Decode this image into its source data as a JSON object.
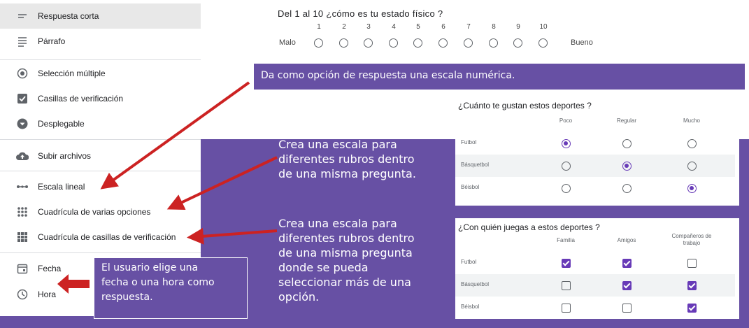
{
  "menu": {
    "items": [
      {
        "label": "Respuesta corta",
        "icon": "short-answer-icon"
      },
      {
        "label": "Párrafo",
        "icon": "paragraph-icon"
      },
      {
        "label": "Selección múltiple",
        "icon": "radio-icon"
      },
      {
        "label": "Casillas de verificación",
        "icon": "checkbox-icon"
      },
      {
        "label": "Desplegable",
        "icon": "dropdown-icon"
      },
      {
        "label": "Subir archivos",
        "icon": "cloud-upload-icon"
      },
      {
        "label": "Escala lineal",
        "icon": "linear-scale-icon"
      },
      {
        "label": "Cuadrícula de varias opciones",
        "icon": "grid-icon"
      },
      {
        "label": "Cuadrícula de casillas de verificación",
        "icon": "grid-icon"
      },
      {
        "label": "Fecha",
        "icon": "calendar-icon"
      },
      {
        "label": "Hora",
        "icon": "clock-icon"
      }
    ]
  },
  "linear_scale": {
    "question": "Del 1 al 10 ¿cómo es tu estado físico ?",
    "numbers": [
      "1",
      "2",
      "3",
      "4",
      "5",
      "6",
      "7",
      "8",
      "9",
      "10"
    ],
    "low_label": "Malo",
    "high_label": "Bueno"
  },
  "callouts": {
    "scale": "Da como opción de respuesta una escala numérica.",
    "grid": "Crea una escala para\ndiferentes rubros dentro\nde una misma pregunta.",
    "checkbox_grid": "Crea una escala para\ndiferentes rubros dentro\nde una misma pregunta\ndonde se pueda\nseleccionar  más de una\nopción.",
    "date_time": "El usuario elige una\nfecha o una hora como\nrespuesta."
  },
  "radio_grid": {
    "question": "¿Cuánto te gustan estos deportes ?",
    "columns": [
      "Poco",
      "Regular",
      "Mucho"
    ],
    "rows": [
      {
        "label": "Futbol",
        "selected": 0
      },
      {
        "label": "Básquetbol",
        "selected": 1
      },
      {
        "label": "Béisbol",
        "selected": 2
      }
    ]
  },
  "checkbox_grid": {
    "question": "¿Con quién juegas a estos deportes ?",
    "columns": [
      "Familia",
      "Amigos",
      "Compañeros de\ntrabajo"
    ],
    "rows": [
      {
        "label": "Futbol",
        "checked": [
          true,
          true,
          false
        ]
      },
      {
        "label": "Básquetbol",
        "checked": [
          false,
          true,
          true
        ]
      },
      {
        "label": "Béisbol",
        "checked": [
          false,
          false,
          true
        ]
      }
    ]
  },
  "colors": {
    "accent": "#6750a4",
    "arrow": "#cc2222",
    "selection": "#673ab7"
  }
}
